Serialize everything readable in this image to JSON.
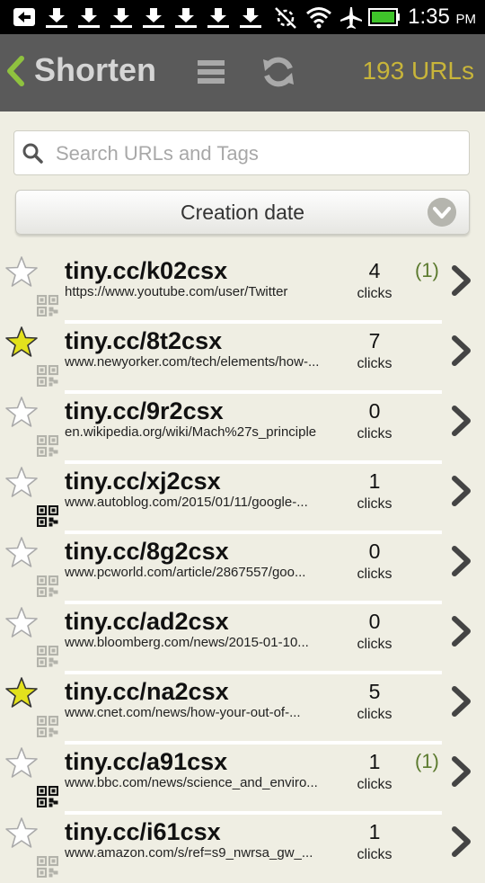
{
  "status": {
    "time": "1:35",
    "ampm": "PM"
  },
  "actionbar": {
    "title": "Shorten",
    "count": "193 URLs"
  },
  "search": {
    "placeholder": "Search URLs and Tags",
    "value": ""
  },
  "sort": {
    "label": "Creation date"
  },
  "colors": {
    "accent": "#c8b53a",
    "star_on": "#e3e11c",
    "new_badge": "#5b7a2e"
  },
  "items": [
    {
      "short": "tiny.cc/k02csx",
      "long": "https://www.youtube.com/user/Twitter",
      "clicks": "4",
      "clicks_label": "clicks",
      "new": "(1)",
      "starred": false,
      "qr_active": false
    },
    {
      "short": "tiny.cc/8t2csx",
      "long": "www.newyorker.com/tech/elements/how-...",
      "clicks": "7",
      "clicks_label": "clicks",
      "new": "",
      "starred": true,
      "qr_active": false
    },
    {
      "short": "tiny.cc/9r2csx",
      "long": "en.wikipedia.org/wiki/Mach%27s_principle",
      "clicks": "0",
      "clicks_label": "clicks",
      "new": "",
      "starred": false,
      "qr_active": false
    },
    {
      "short": "tiny.cc/xj2csx",
      "long": "www.autoblog.com/2015/01/11/google-...",
      "clicks": "1",
      "clicks_label": "clicks",
      "new": "",
      "starred": false,
      "qr_active": true
    },
    {
      "short": "tiny.cc/8g2csx",
      "long": "www.pcworld.com/article/2867557/goo...",
      "clicks": "0",
      "clicks_label": "clicks",
      "new": "",
      "starred": false,
      "qr_active": false
    },
    {
      "short": "tiny.cc/ad2csx",
      "long": "www.bloomberg.com/news/2015-01-10...",
      "clicks": "0",
      "clicks_label": "clicks",
      "new": "",
      "starred": false,
      "qr_active": false
    },
    {
      "short": "tiny.cc/na2csx",
      "long": "www.cnet.com/news/how-your-out-of-...",
      "clicks": "5",
      "clicks_label": "clicks",
      "new": "",
      "starred": true,
      "qr_active": false
    },
    {
      "short": "tiny.cc/a91csx",
      "long": "www.bbc.com/news/science_and_enviro...",
      "clicks": "1",
      "clicks_label": "clicks",
      "new": "(1)",
      "starred": false,
      "qr_active": true
    },
    {
      "short": "tiny.cc/i61csx",
      "long": "www.amazon.com/s/ref=s9_nwrsa_gw_...",
      "clicks": "1",
      "clicks_label": "clicks",
      "new": "",
      "starred": false,
      "qr_active": false
    }
  ]
}
